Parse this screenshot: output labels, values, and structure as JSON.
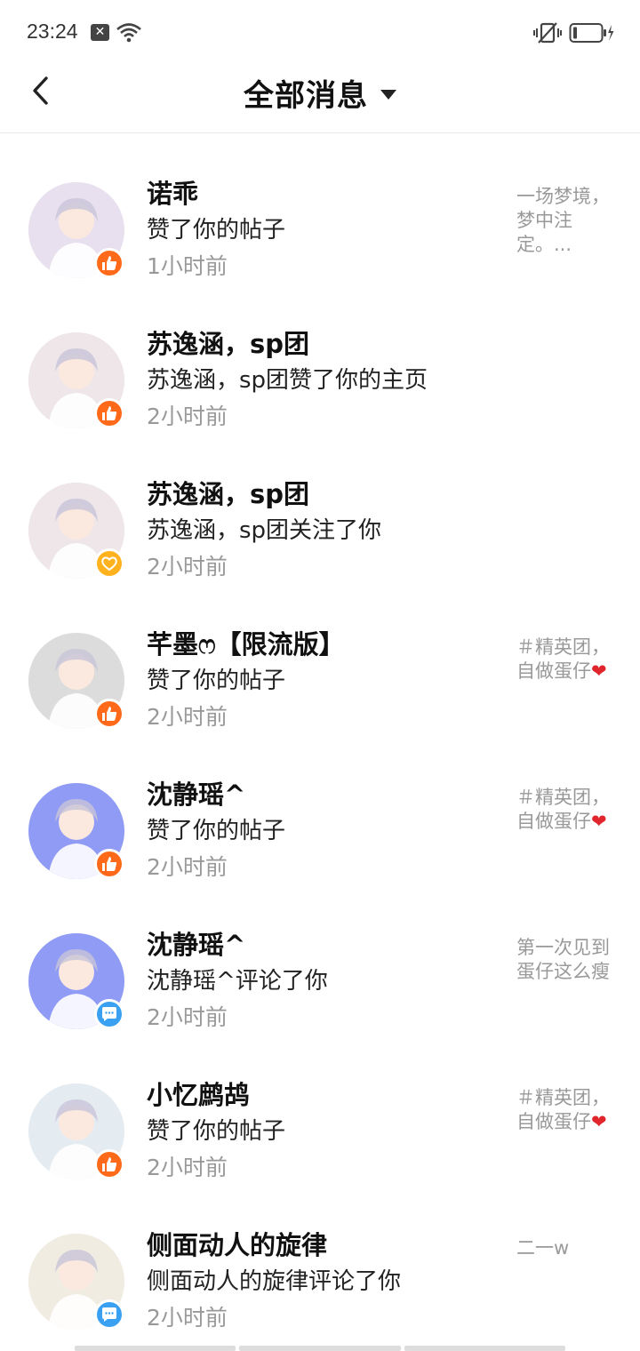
{
  "status_bar": {
    "time": "23:24",
    "notification_icon": "x-icon"
  },
  "header": {
    "title": "全部消息",
    "back_icon": "chevron-left-icon",
    "dropdown_icon": "triangle-down-icon"
  },
  "messages": [
    {
      "name": "诺乖",
      "action": "赞了你的帖子",
      "time": "1小时前",
      "badge": "like",
      "preview": "一场梦境，梦中注定。...",
      "avatar_color": "#e8e0ee"
    },
    {
      "name": "苏逸涵，sp团",
      "action": "苏逸涵，sp团赞了你的主页",
      "time": "2小时前",
      "badge": "like",
      "preview": "",
      "avatar_color": "#eee6e8"
    },
    {
      "name": "苏逸涵，sp团",
      "action": "苏逸涵，sp团关注了你",
      "time": "2小时前",
      "badge": "follow",
      "preview": "",
      "avatar_color": "#eee6e8"
    },
    {
      "name": "芊墨ෆ【限流版】",
      "action": "赞了你的帖子",
      "time": "2小时前",
      "badge": "like",
      "preview": "＃精英团，自做蛋仔",
      "preview_heart": "❤",
      "avatar_color": "#dcdcdc"
    },
    {
      "name": "沈静瑶^",
      "action": "赞了你的帖子",
      "time": "2小时前",
      "badge": "like",
      "preview": "＃精英团，自做蛋仔",
      "preview_heart": "❤",
      "avatar_color": "#8f9bf5"
    },
    {
      "name": "沈静瑶^",
      "action": "沈静瑶^评论了你",
      "time": "2小时前",
      "badge": "comment",
      "preview": "第一次见到蛋仔这么瘦",
      "avatar_color": "#8f9bf5"
    },
    {
      "name": "小忆鹧鸪",
      "action": "赞了你的帖子",
      "time": "2小时前",
      "badge": "like",
      "preview": "＃精英团，自做蛋仔",
      "preview_heart": "❤",
      "avatar_color": "#e4ecf2"
    },
    {
      "name": "侧面动人的旋律",
      "action": "侧面动人的旋律评论了你",
      "time": "2小时前",
      "badge": "comment",
      "preview": "二一w",
      "avatar_color": "#f1ece2"
    }
  ]
}
